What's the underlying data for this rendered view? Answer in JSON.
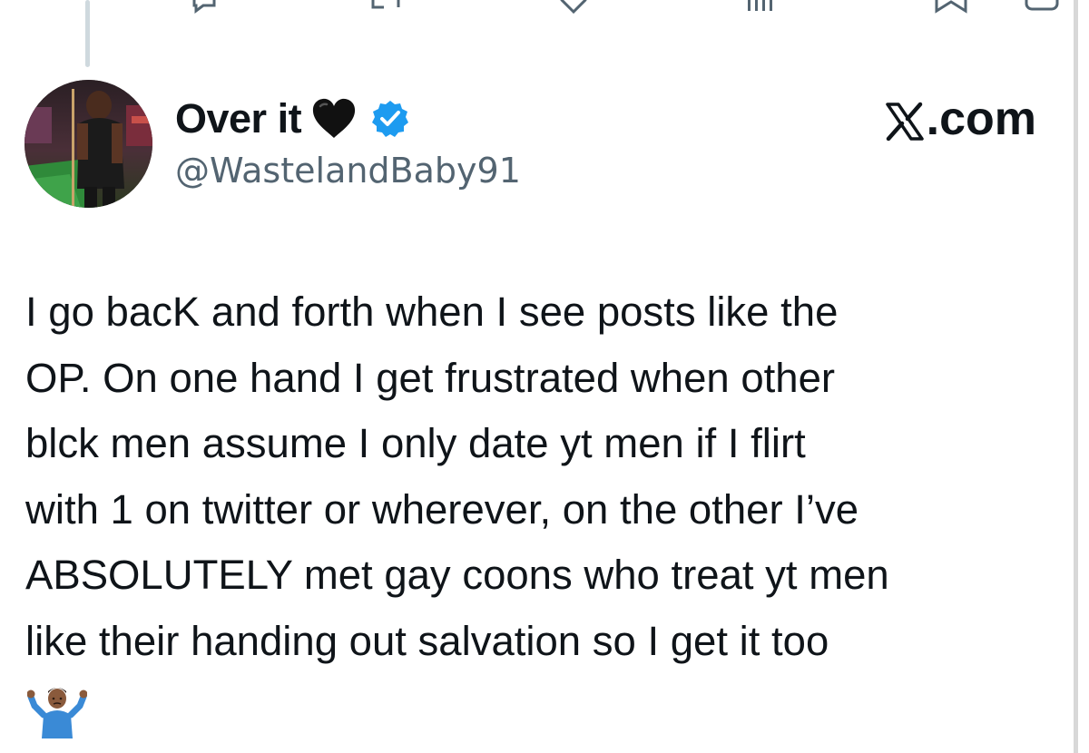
{
  "tweet": {
    "display_name": "Over it",
    "name_emoji": "black-heart-icon",
    "verified": true,
    "handle": "@WastelandBaby91",
    "text": "I go bacK and forth when I see posts like the\nOP. On one hand I get frustrated when other\nblck men assume I only date yt men if I flirt\nwith 1 on twitter or wherever, on the other I’ve\nABSOLUTELY met gay coons who treat yt men\nlike their handing out salvation so I get it too",
    "trailing_emoji": "person-shrugging-icon"
  },
  "brand": {
    "suffix": ".com"
  },
  "colors": {
    "verified_blue": "#1d9bf0",
    "text": "#0f1419",
    "secondary_text": "#536471",
    "thread_line": "#cfd9de"
  }
}
